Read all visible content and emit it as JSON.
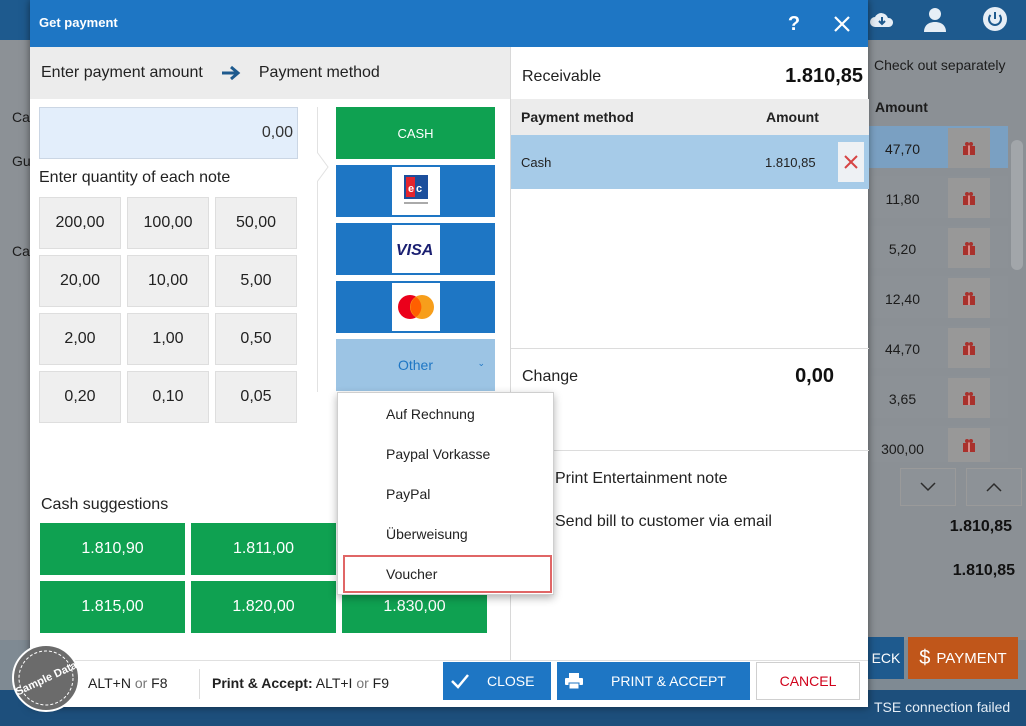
{
  "dialog": {
    "title": "Get payment",
    "help_label": "?",
    "step1": "Enter payment amount",
    "step2": "Payment method",
    "amount_value": "0,00",
    "note_label": "Enter quantity of each note",
    "notes": [
      "200,00",
      "100,00",
      "50,00",
      "20,00",
      "10,00",
      "5,00",
      "2,00",
      "1,00",
      "0,50",
      "0,20",
      "0,10",
      "0,05"
    ],
    "payment_methods": {
      "cash": "CASH",
      "other": "Other",
      "cards": [
        "ec-card-icon",
        "visa-card-icon",
        "mastercard-icon"
      ]
    },
    "cash_suggestions_label": "Cash suggestions",
    "cash_suggestions": [
      "1.810,90",
      "1.811,00",
      "1.815,00",
      "1.820,00",
      "1.830,00"
    ],
    "other_menu": [
      "Auf Rechnung",
      "Paypal Vorkasse",
      "PayPal",
      "Überweisung",
      "Voucher"
    ],
    "receivable_label": "Receivable",
    "receivable_value": "1.810,85",
    "table_head": {
      "method": "Payment method",
      "amount": "Amount"
    },
    "rows": [
      {
        "method": "Cash",
        "amount": "1.810,85"
      }
    ],
    "change_label": "Change",
    "change_value": "0,00",
    "option_print": "Print Entertainment note",
    "option_email": "Send bill to customer via email",
    "shortcut1_keys": "ALT+N",
    "shortcut1_or": "or",
    "shortcut1_f": "F8",
    "shortcut2_label": "Print & Accept:",
    "shortcut2_keys": "ALT+I",
    "shortcut2_or": "or",
    "shortcut2_f": "F9",
    "close_label": "CLOSE",
    "print_label": "PRINT & ACCEPT",
    "cancel_label": "CANCEL"
  },
  "background": {
    "check_out": "Check out separately",
    "amount_header": "Amount",
    "amounts": [
      "47,70",
      "11,80",
      "5,20",
      "12,40",
      "44,70",
      "3,65",
      "300,00"
    ],
    "total1": "1.810,85",
    "total2": "1.810,85",
    "payment_label": "PAYMENT",
    "eck_label": "ECK",
    "tse_status": "TSE connection failed",
    "left_labels": [
      "Ca",
      "Gu",
      "Ca"
    ]
  },
  "badge": "Sample Data",
  "colors": {
    "brand_blue": "#1e76c4",
    "green": "#0fa151",
    "cancel_red": "#d0021b",
    "payment_orange": "#c0561a"
  }
}
